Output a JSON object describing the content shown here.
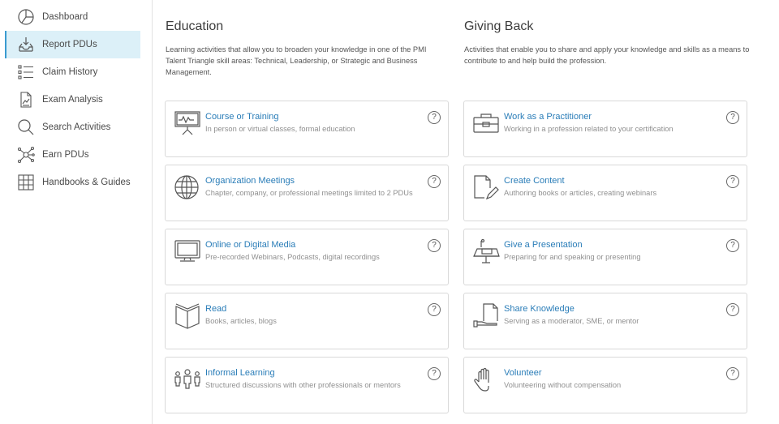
{
  "sidebar": {
    "items": [
      {
        "label": "Dashboard",
        "icon": "pie-chart-icon",
        "active": false
      },
      {
        "label": "Report PDUs",
        "icon": "inbox-download-icon",
        "active": true
      },
      {
        "label": "Claim History",
        "icon": "list-icon",
        "active": false
      },
      {
        "label": "Exam Analysis",
        "icon": "document-chart-icon",
        "active": false
      },
      {
        "label": "Search Activities",
        "icon": "search-icon",
        "active": false
      },
      {
        "label": "Earn PDUs",
        "icon": "network-icon",
        "active": false
      },
      {
        "label": "Handbooks & Guides",
        "icon": "grid-icon",
        "active": false
      }
    ]
  },
  "education": {
    "title": "Education",
    "description": "Learning activities that allow you to broaden your knowledge in one of the PMI Talent Triangle skill areas: Technical, Leadership, or Strategic and Business Management.",
    "cards": [
      {
        "title": "Course or Training",
        "subtitle": "In person or virtual classes, formal education",
        "icon": "presentation-board-icon"
      },
      {
        "title": "Organization Meetings",
        "subtitle": "Chapter, company, or professional meetings limited to 2 PDUs",
        "icon": "globe-icon"
      },
      {
        "title": "Online or Digital Media",
        "subtitle": "Pre-recorded Webinars, Podcasts, digital recordings",
        "icon": "monitor-icon"
      },
      {
        "title": "Read",
        "subtitle": "Books, articles, blogs",
        "icon": "open-book-icon"
      },
      {
        "title": "Informal Learning",
        "subtitle": "Structured discussions with other professionals or mentors",
        "icon": "people-group-icon"
      }
    ]
  },
  "giving_back": {
    "title": "Giving Back",
    "description": "Activities that enable you to share and apply your knowledge and skills as a means to contribute to and help build the profession.",
    "cards": [
      {
        "title": "Work as a Practitioner",
        "subtitle": "Working in a profession related to your certification",
        "icon": "briefcase-icon"
      },
      {
        "title": "Create Content",
        "subtitle": "Authoring books or articles, creating webinars",
        "icon": "document-pencil-icon"
      },
      {
        "title": "Give a Presentation",
        "subtitle": "Preparing for and speaking or presenting",
        "icon": "podium-icon"
      },
      {
        "title": "Share Knowledge",
        "subtitle": "Serving as a moderator, SME, or mentor",
        "icon": "hand-document-icon"
      },
      {
        "title": "Volunteer",
        "subtitle": "Volunteering without compensation",
        "icon": "raised-hand-icon"
      }
    ]
  },
  "help_glyph": "?",
  "colors": {
    "accent": "#2a7db8",
    "active_bg": "#dcf0f8",
    "active_border": "#3a9bd0"
  }
}
